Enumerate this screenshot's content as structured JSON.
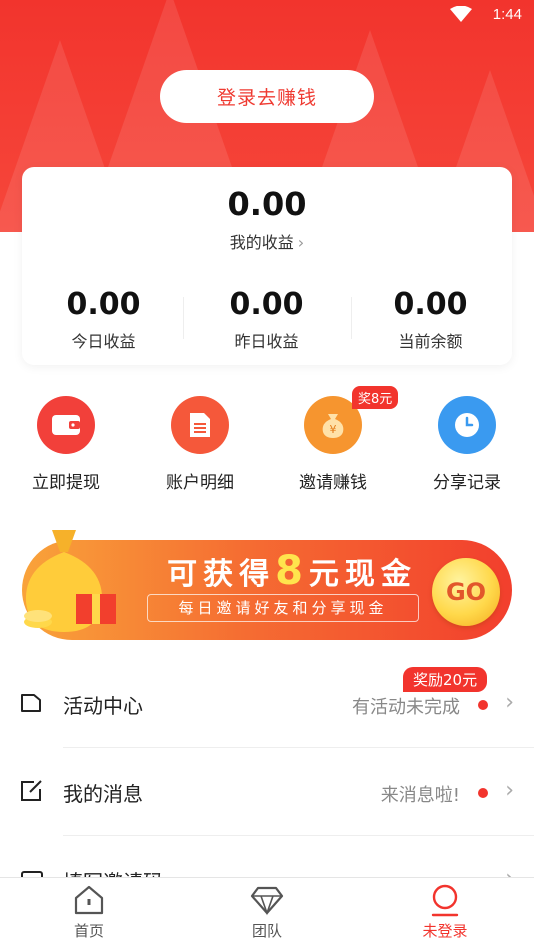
{
  "status_bar": {
    "time": "1:44"
  },
  "header": {
    "login_button": "登录去赚钱"
  },
  "earnings": {
    "total_value": "0.00",
    "total_label": "我的收益",
    "stats": [
      {
        "value": "0.00",
        "label": "今日收益"
      },
      {
        "value": "0.00",
        "label": "昨日收益"
      },
      {
        "value": "0.00",
        "label": "当前余额"
      }
    ]
  },
  "quick_actions": [
    {
      "label": "立即提现",
      "icon": "wallet-icon",
      "color": "#f2403a"
    },
    {
      "label": "账户明细",
      "icon": "document-icon",
      "color": "#f5583a"
    },
    {
      "label": "邀请赚钱",
      "icon": "money-bag-icon",
      "color": "#f6952f",
      "badge": "奖8元"
    },
    {
      "label": "分享记录",
      "icon": "clock-icon",
      "color": "#3a9af0"
    }
  ],
  "banner": {
    "title_prefix": "可获得",
    "title_number": "8",
    "title_suffix": "元现金",
    "subtitle": "每日邀请好友和分享现金",
    "go_label": "GO"
  },
  "list": [
    {
      "title": "活动中心",
      "hint": "有活动未完成",
      "badge": "奖励20元",
      "icon": "folder-icon"
    },
    {
      "title": "我的消息",
      "hint": "来消息啦!",
      "icon": "edit-message-icon"
    },
    {
      "title": "填写邀请码",
      "icon": "ticket-icon"
    }
  ],
  "bottom_nav": [
    {
      "label": "首页",
      "icon": "home-icon"
    },
    {
      "label": "团队",
      "icon": "diamond-icon"
    },
    {
      "label": "未登录",
      "icon": "user-icon",
      "active": true
    }
  ],
  "colors": {
    "brand_red": "#f2342d",
    "accent_orange": "#f6952f",
    "accent_blue": "#3a9af0"
  }
}
